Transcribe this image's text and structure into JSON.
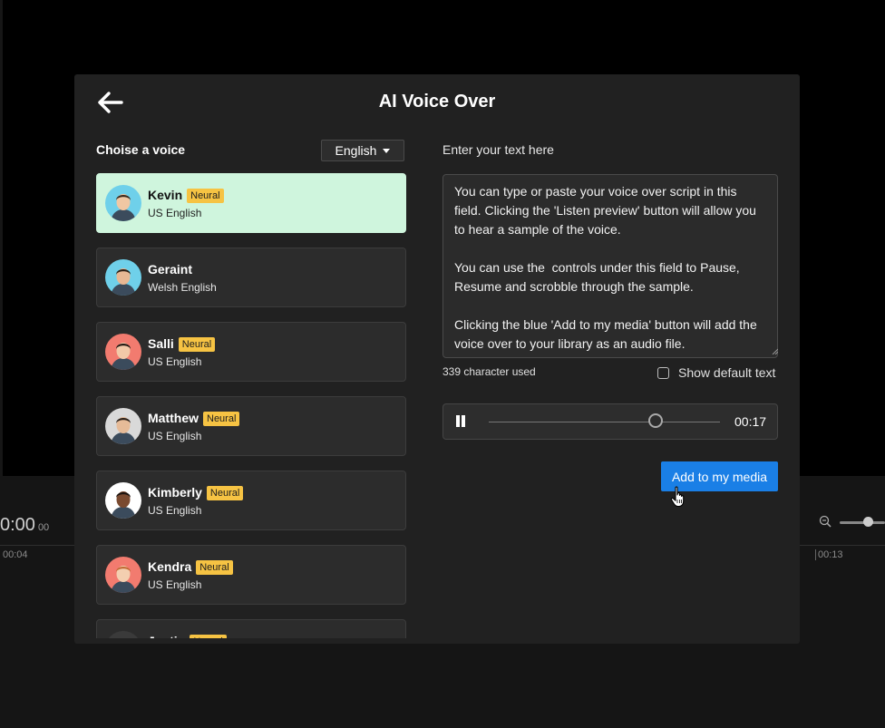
{
  "background": {
    "timecode": "0:00",
    "timecode_frames": "00",
    "ruler_ticks": [
      "00:04",
      "00:13"
    ]
  },
  "modal": {
    "title": "AI Voice Over",
    "back_icon": "arrow-left-icon"
  },
  "voices_panel": {
    "title": "Choise a voice",
    "language_dropdown": {
      "selected": "English",
      "icon": "caret-down-icon"
    },
    "voices": [
      {
        "name": "Kevin",
        "badge": "Neural",
        "accent": "US English",
        "selected": true,
        "avatar_bg": "#6fd0ea",
        "skin": "#f0c7a3",
        "hair": "#3a2a1e"
      },
      {
        "name": "Geraint",
        "badge": "",
        "accent": "Welsh English",
        "selected": false,
        "avatar_bg": "#6fd0ea",
        "skin": "#e8b894",
        "hair": "#2d2118"
      },
      {
        "name": "Salli",
        "badge": "Neural",
        "accent": "US English",
        "selected": false,
        "avatar_bg": "#f27b6f",
        "skin": "#f2c9a8",
        "hair": "#241a14"
      },
      {
        "name": "Matthew",
        "badge": "Neural",
        "accent": "US English",
        "selected": false,
        "avatar_bg": "#d9d9d9",
        "skin": "#e6bb98",
        "hair": "#2b211a"
      },
      {
        "name": "Kimberly",
        "badge": "Neural",
        "accent": "US English",
        "selected": false,
        "avatar_bg": "#ffffff",
        "skin": "#7a4a30",
        "hair": "#1c1410"
      },
      {
        "name": "Kendra",
        "badge": "Neural",
        "accent": "US English",
        "selected": false,
        "avatar_bg": "#f27b6f",
        "skin": "#f3cfb0",
        "hair": "#c26a34"
      },
      {
        "name": "Justin",
        "badge": "Neural",
        "accent": "",
        "selected": false,
        "avatar_bg": "#3a3a3a",
        "skin": "#e0b08c",
        "hair": "#1c1410"
      }
    ]
  },
  "text_panel": {
    "title": "Enter your text here",
    "text_value": "You can type or paste your voice over script in this field. Clicking the 'Listen preview' button will allow you to hear a sample of the voice.\n\nYou can use the  controls under this field to Pause, Resume and scrobble through the sample.\n\nClicking the blue 'Add to my media' button will add the voice over to your library as an audio file.",
    "char_count": "339 character used",
    "show_default_label": "Show default text",
    "show_default_checked": false
  },
  "player": {
    "state": "playing",
    "pause_icon": "pause-icon",
    "time": "00:17",
    "progress": 0.72
  },
  "actions": {
    "add_media_label": "Add to my media",
    "accent_color": "#1a7fe6"
  }
}
